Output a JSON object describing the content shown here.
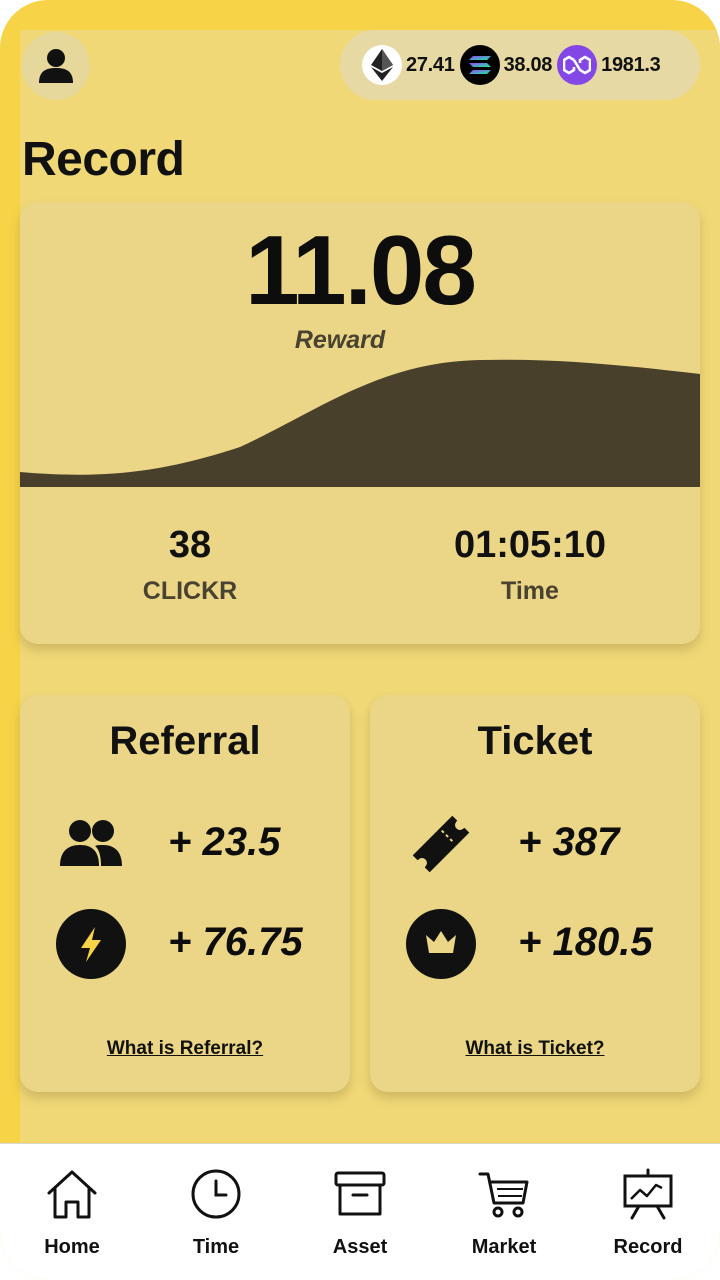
{
  "header": {
    "balances": [
      {
        "icon": "ethereum-icon",
        "value": "27.41"
      },
      {
        "icon": "solana-icon",
        "value": "38.08"
      },
      {
        "icon": "polygon-icon",
        "value": "1981.3"
      }
    ]
  },
  "page_title": "Record",
  "reward": {
    "value": "11.08",
    "label": "Reward",
    "stats": [
      {
        "value": "38",
        "label": "CLICKR"
      },
      {
        "value": "01:05:10",
        "label": "Time"
      }
    ]
  },
  "referral": {
    "title": "Referral",
    "rows": [
      {
        "icon": "users-icon",
        "value": "+ 23.5"
      },
      {
        "icon": "lightning-icon",
        "value": "+ 76.75"
      }
    ],
    "link": "What is Referral?"
  },
  "ticket": {
    "title": "Ticket",
    "rows": [
      {
        "icon": "ticket-icon",
        "value": "+ 387"
      },
      {
        "icon": "crown-icon",
        "value": "+ 180.5"
      }
    ],
    "link": "What is Ticket?"
  },
  "nav": [
    {
      "label": "Home",
      "icon": "home-icon"
    },
    {
      "label": "Time",
      "icon": "clock-icon"
    },
    {
      "label": "Asset",
      "icon": "archive-box-icon"
    },
    {
      "label": "Market",
      "icon": "cart-icon"
    },
    {
      "label": "Record",
      "icon": "chart-board-icon"
    }
  ],
  "colors": {
    "background": "#f7d348",
    "panel": "#f0d877",
    "card": "#ead686",
    "wave": "#48402a",
    "lightning": "#f7d348",
    "polygon": "#8247e5"
  }
}
